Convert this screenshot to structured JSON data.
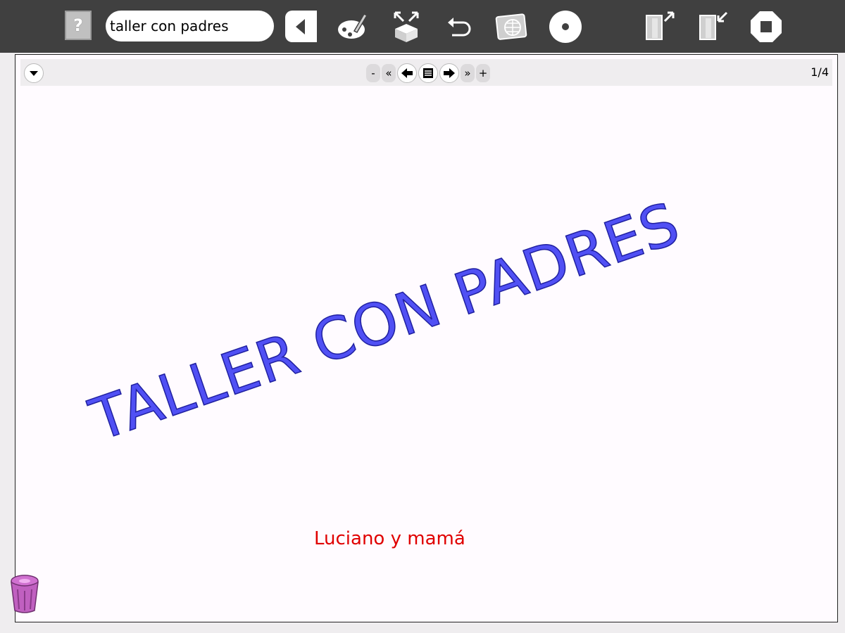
{
  "toolbar": {
    "help_label": "?",
    "title_value": "taller con padres",
    "icons": [
      "back-icon",
      "paint-icon",
      "resize-box-icon",
      "undo-icon",
      "web-icon",
      "record-icon",
      "export-icon",
      "import-icon",
      "stop-icon"
    ]
  },
  "nav": {
    "minus": "-",
    "first": "«",
    "last": "»",
    "plus": "+",
    "page_count": "1/4"
  },
  "slide": {
    "title": "TALLER CON PADRES",
    "caption": "Luciano y mamá"
  },
  "colors": {
    "toolbar_bg": "#404040",
    "title_color": "#5050f4",
    "caption_color": "#e00000",
    "trash_color": "#c060c0"
  }
}
